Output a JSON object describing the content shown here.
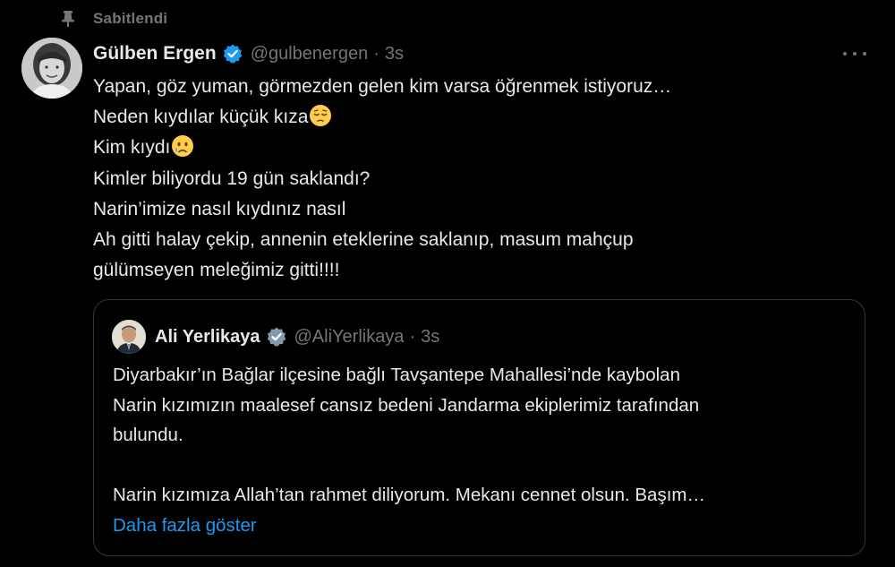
{
  "pinned": {
    "label": "Sabitlendi",
    "icon": "pin-icon"
  },
  "tweet": {
    "display_name": "Gülben Ergen",
    "handle": "@gulbenergen",
    "separator": "·",
    "time": "3s",
    "verified": true,
    "badge_color": "#1d9bf0",
    "more_icon": "more-horizontal-icon",
    "lines": [
      {
        "text": "Yapan, göz yuman, görmezden gelen kim varsa öğrenmek istiyoruz…",
        "emoji": ""
      },
      {
        "text": "Neden kıydılar küçük kıza",
        "emoji": "pensive-face"
      },
      {
        "text": "Kim kıydı",
        "emoji": "crying-face"
      },
      {
        "text": "Kimler biliyordu 19 gün saklandı?",
        "emoji": ""
      },
      {
        "text": "Narin’imize nasıl kıydınız nasıl",
        "emoji": ""
      },
      {
        "text": "Ah gitti halay çekip, annenin eteklerine saklanıp, masum mahçup",
        "emoji": ""
      },
      {
        "text": "gülümseyen meleğimiz gitti!!!!",
        "emoji": ""
      }
    ]
  },
  "quote": {
    "display_name": "Ali Yerlikaya",
    "handle": "@AliYerlikaya",
    "separator": "·",
    "time": "3s",
    "verified": true,
    "badge_color": "#829aab",
    "lines": [
      "Diyarbakır’ın Bağlar ilçesine bağlı Tavşantepe Mahallesi’nde kaybolan",
      "Narin kızımızın maalesef cansız bedeni Jandarma ekiplerimiz tarafından",
      "bulundu.",
      "",
      "Narin kızımıza Allah’tan rahmet diliyorum. Mekanı cennet olsun. Başım…"
    ],
    "show_more": "Daha fazla göster",
    "link_color": "#1d9bf0"
  },
  "theme": {
    "background": "#000000",
    "text": "#e7e9ea",
    "secondary_text": "#71767b",
    "border": "#333639"
  }
}
